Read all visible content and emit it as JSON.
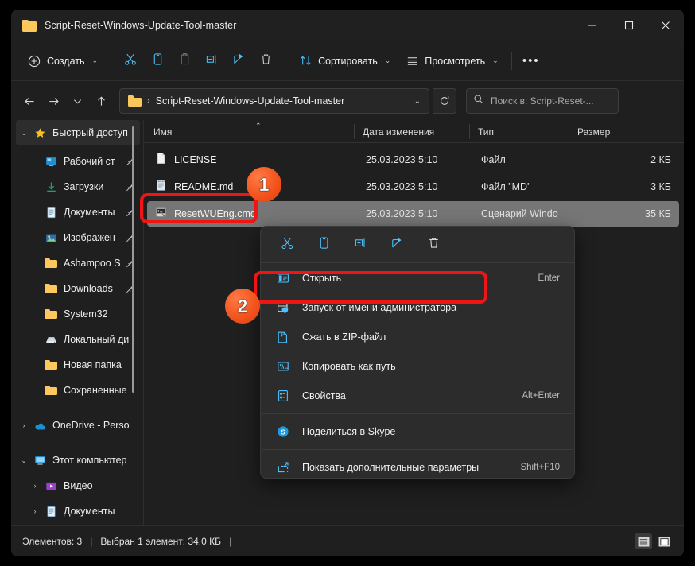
{
  "window": {
    "title": "Script-Reset-Windows-Update-Tool-master",
    "folder_icon": "folder-icon",
    "controls": {
      "minimize": "minimize-icon",
      "maximize": "maximize-icon",
      "close": "close-icon"
    }
  },
  "toolbar": {
    "new_label": "Создать",
    "sort_label": "Сортировать",
    "view_label": "Просмотреть",
    "more_label": "•••",
    "icons": {
      "new": "plus-circle-icon",
      "cut": "scissors-icon",
      "copy": "copy-icon",
      "paste": "paste-icon",
      "rename": "rename-icon",
      "share": "share-icon",
      "delete": "trash-icon",
      "sort": "sort-arrows-icon",
      "view": "list-lines-icon",
      "more": "ellipsis-icon"
    }
  },
  "address": {
    "back": "back-arrow-icon",
    "forward": "forward-arrow-icon",
    "recent": "chevron-down-icon",
    "up": "up-arrow-icon",
    "folder_icon": "folder-icon",
    "separator": "›",
    "path": "Script-Reset-Windows-Update-Tool-master",
    "dropdown": "chevron-down-icon",
    "refresh": "refresh-icon"
  },
  "search": {
    "icon": "search-icon",
    "placeholder": "Поиск в: Script-Reset-..."
  },
  "sidebar": {
    "scrollbar": "vertical-scrollbar",
    "items": [
      {
        "label": "Быстрый доступ",
        "icon": "star-icon",
        "chevron": "chevron-down",
        "selected": true,
        "indent": false,
        "pinned": false
      },
      {
        "label": "Рабочий ст",
        "icon": "desktop-icon",
        "chevron": "",
        "selected": false,
        "indent": true,
        "pinned": true
      },
      {
        "label": "Загрузки",
        "icon": "download-icon",
        "chevron": "",
        "selected": false,
        "indent": true,
        "pinned": true
      },
      {
        "label": "Документы",
        "icon": "document-icon",
        "chevron": "",
        "selected": false,
        "indent": true,
        "pinned": true
      },
      {
        "label": "Изображен",
        "icon": "pictures-icon",
        "chevron": "",
        "selected": false,
        "indent": true,
        "pinned": true
      },
      {
        "label": "Ashampoo S",
        "icon": "folder-icon",
        "chevron": "",
        "selected": false,
        "indent": true,
        "pinned": true
      },
      {
        "label": "Downloads",
        "icon": "folder-icon",
        "chevron": "",
        "selected": false,
        "indent": true,
        "pinned": true
      },
      {
        "label": "System32",
        "icon": "folder-icon",
        "chevron": "",
        "selected": false,
        "indent": true,
        "pinned": false
      },
      {
        "label": "Локальный ди",
        "icon": "drive-icon",
        "chevron": "",
        "selected": false,
        "indent": true,
        "pinned": false
      },
      {
        "label": "Новая папка",
        "icon": "folder-icon",
        "chevron": "",
        "selected": false,
        "indent": true,
        "pinned": false
      },
      {
        "label": "Сохраненные",
        "icon": "folder-icon",
        "chevron": "",
        "selected": false,
        "indent": true,
        "pinned": false
      },
      {
        "label": "OneDrive - Perso",
        "icon": "onedrive-icon",
        "chevron": "chevron-right",
        "selected": false,
        "indent": false,
        "pinned": false
      },
      {
        "label": "Этот компьютер",
        "icon": "this-pc-icon",
        "chevron": "chevron-down",
        "selected": false,
        "indent": false,
        "pinned": false
      },
      {
        "label": "Видео",
        "icon": "video-icon",
        "chevron": "chevron-right",
        "selected": false,
        "indent": true,
        "pinned": false
      },
      {
        "label": "Документы",
        "icon": "document-icon",
        "chevron": "chevron-right",
        "selected": false,
        "indent": true,
        "pinned": false
      }
    ]
  },
  "filelist": {
    "columns": [
      {
        "label": "Имя",
        "sorted": true
      },
      {
        "label": "Дата изменения",
        "sorted": false
      },
      {
        "label": "Тип",
        "sorted": false
      },
      {
        "label": "Размер",
        "sorted": false
      }
    ],
    "sort_caret": "▲",
    "rows": [
      {
        "name": "LICENSE",
        "icon": "file-blank-icon",
        "date": "25.03.2023 5:10",
        "type": "Файл",
        "size": "2 КБ",
        "selected": false
      },
      {
        "name": "README.md",
        "icon": "md-file-icon",
        "date": "25.03.2023 5:10",
        "type": "Файл \"MD\"",
        "size": "3 КБ",
        "selected": false
      },
      {
        "name": "ResetWUEng.cmd",
        "icon": "cmd-script-icon",
        "date": "25.03.2023 5:10",
        "type": "Сценарий Windo",
        "size": "35 КБ",
        "selected": true
      }
    ]
  },
  "context_menu": {
    "icon_row": [
      {
        "name": "cut-icon"
      },
      {
        "name": "copy-icon"
      },
      {
        "name": "rename-icon"
      },
      {
        "name": "share-icon"
      },
      {
        "name": "delete-icon"
      }
    ],
    "items": [
      {
        "label": "Открыть",
        "accel": "Enter",
        "icon": "open-icon",
        "divider_after": false,
        "highlighted": false
      },
      {
        "label": "Запуск от имени администратора",
        "accel": "",
        "icon": "shield-run-icon",
        "divider_after": false,
        "highlighted": true
      },
      {
        "label": "Сжать в ZIP-файл",
        "accel": "",
        "icon": "zip-icon",
        "divider_after": false,
        "highlighted": false
      },
      {
        "label": "Копировать как путь",
        "accel": "",
        "icon": "copy-path-icon",
        "divider_after": false,
        "highlighted": false
      },
      {
        "label": "Свойства",
        "accel": "Alt+Enter",
        "icon": "properties-icon",
        "divider_after": true,
        "highlighted": false
      },
      {
        "label": "Поделиться в Skype",
        "accel": "",
        "icon": "skype-icon",
        "divider_after": true,
        "highlighted": false
      },
      {
        "label": "Показать дополнительные параметры",
        "accel": "Shift+F10",
        "icon": "more-options-icon",
        "divider_after": false,
        "highlighted": false
      }
    ]
  },
  "statusbar": {
    "items_count": "Элементов: 3",
    "separator": "|",
    "selection": "Выбран 1 элемент: 34,0 КБ",
    "trailing_separator": "|",
    "view_details_icon": "details-view-icon",
    "view_tiles_icon": "large-icons-view-icon"
  },
  "annotations": {
    "badge_one": "1",
    "badge_two": "2",
    "highlight_color": "#f01414"
  }
}
